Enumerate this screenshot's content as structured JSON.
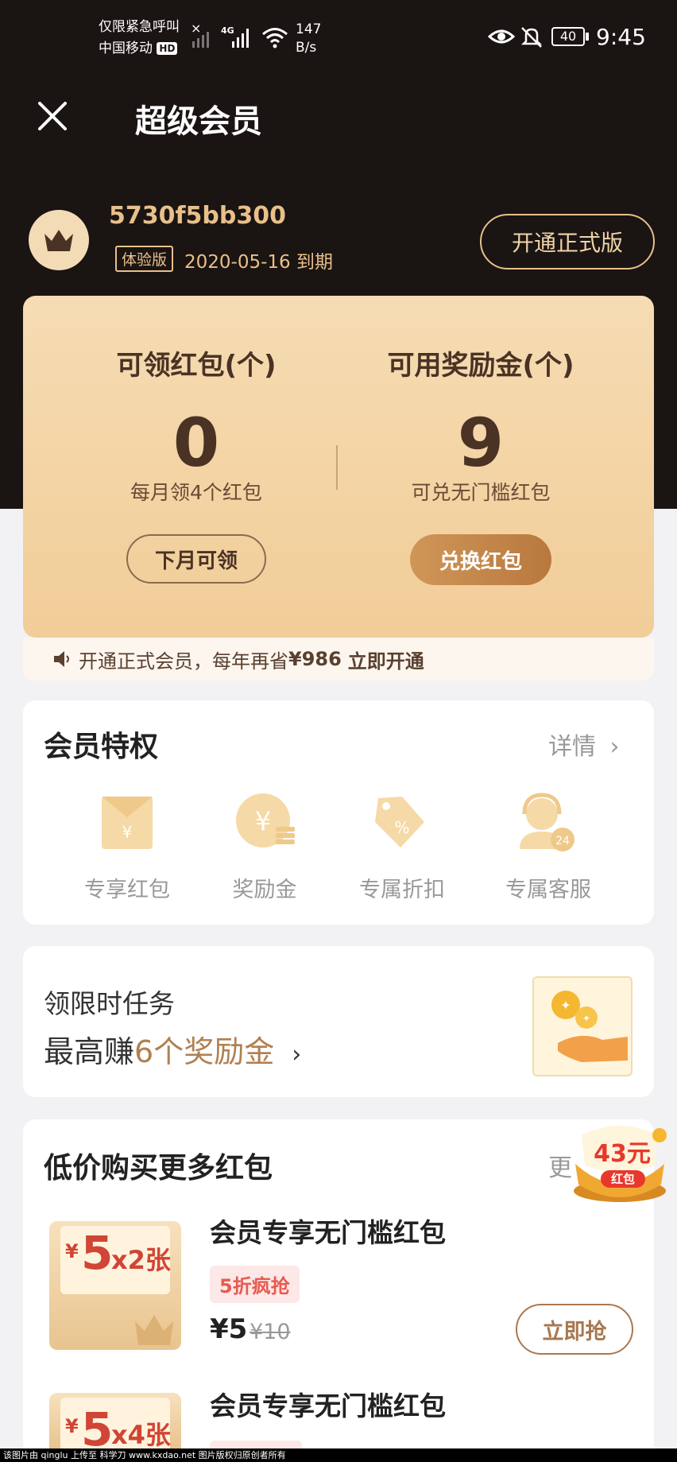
{
  "status_bar": {
    "line1": "仅限紧急呼叫",
    "line2": "中国移动",
    "hd": "HD",
    "net": "4G",
    "speed_value": "147",
    "speed_unit": "B/s",
    "battery": "40",
    "time": "9:45"
  },
  "header": {
    "title": "超级会员"
  },
  "user": {
    "name": "5730f5bb300",
    "badge": "体验版",
    "expire": "2020-05-16 到期",
    "open_button": "开通正式版"
  },
  "stats": {
    "left": {
      "label": "可领红包(个)",
      "value": "0",
      "sub": "每月领4个红包",
      "button": "下月可领"
    },
    "right": {
      "label": "可用奖励金(个)",
      "value": "9",
      "sub": "可兑无门槛红包",
      "button": "兑换红包"
    }
  },
  "notice": {
    "text": "开通正式会员，每年再省",
    "amount": "¥986",
    "link": "立即开通"
  },
  "privileges": {
    "title": "会员特权",
    "more": "详情",
    "items": [
      {
        "label": "专享红包",
        "icon": "red-envelope-icon"
      },
      {
        "label": "奖励金",
        "icon": "coin-icon"
      },
      {
        "label": "专属折扣",
        "icon": "discount-tag-icon"
      },
      {
        "label": "专属客服",
        "icon": "customer-service-icon"
      }
    ],
    "service_badge": "24"
  },
  "task": {
    "line1": "领限时任务",
    "line2_prefix": "最高赚",
    "line2_highlight": "6个奖励金"
  },
  "buy": {
    "title": "低价购买更多红包",
    "more": "更",
    "float_badge": {
      "amount": "43元",
      "label": "红包"
    },
    "products": [
      {
        "title": "会员专享无门槛红包",
        "env_currency": "¥",
        "env_amount": "5",
        "env_qty": "x2张",
        "discount": "5折疯抢",
        "price": "¥5",
        "old_price": "¥10",
        "button": "立即抢"
      },
      {
        "title": "会员专享无门槛红包",
        "env_currency": "¥",
        "env_amount": "5",
        "env_qty": "x4张",
        "discount": "",
        "price": "",
        "old_price": "",
        "button": ""
      }
    ]
  },
  "watermark": "该图片由 qinglu 上传至 科学刀 www.kxdao.net 图片版权归原创者所有",
  "colors": {
    "dark_bg": "#1a1413",
    "gold": "#e8c08a",
    "accent": "#b08050",
    "red": "#e85a50"
  }
}
